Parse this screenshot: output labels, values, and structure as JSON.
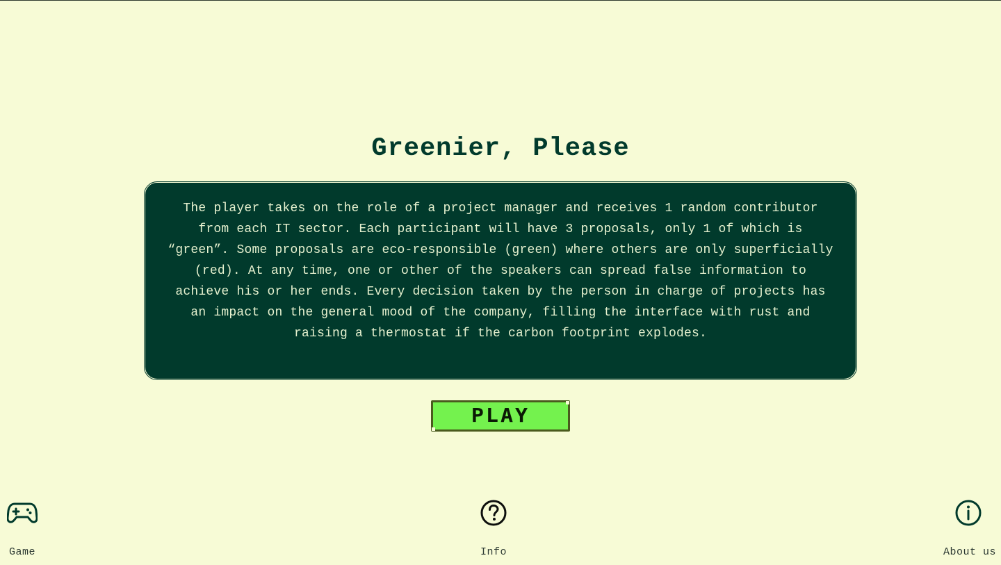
{
  "title": "Greenier, Please",
  "description": "The player takes on the role of a project manager and receives 1 random contributor from each IT sector. Each participant will have 3 proposals, only 1 of which is “green”. Some proposals are eco-responsible (green) where others are only superficially (red). At any time, one or other of the speakers can spread false information to achieve his or her ends. Every decision taken by the person in charge of projects has an impact on the general mood of the company, filling the interface with rust and raising a thermostat if the carbon footprint explodes.",
  "play_button": {
    "label": "PLAY"
  },
  "nav": {
    "game": {
      "label": "Game",
      "icon": "gamepad-icon"
    },
    "info": {
      "label": "Info",
      "icon": "question-circle-icon"
    },
    "about": {
      "label": "About us",
      "icon": "info-circle-icon"
    }
  },
  "colors": {
    "background": "#f7fbd6",
    "primary_dark_green": "#013a2c",
    "play_button_green": "#74f24e",
    "play_button_border": "#4a5a1e"
  }
}
